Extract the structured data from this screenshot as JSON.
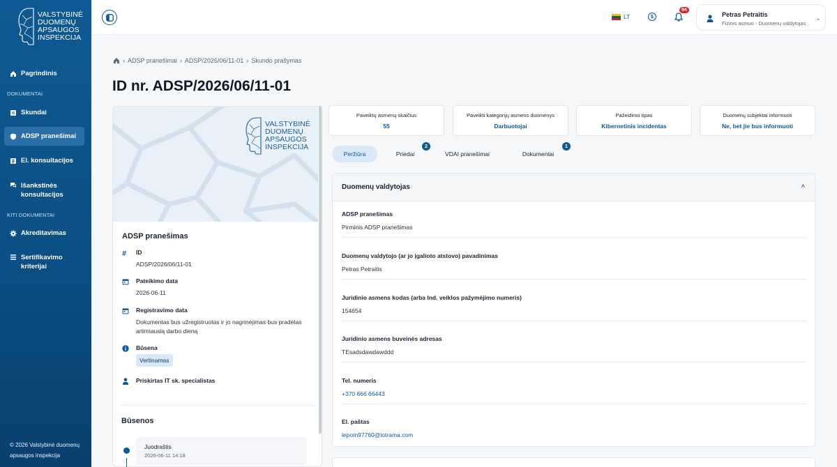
{
  "brand": {
    "line1": "VALSTYBINĖ",
    "line2": "DUOMENŲ",
    "line3": "APSAUGOS",
    "line4": "INSPEKCIJA"
  },
  "sidebar": {
    "items": [
      {
        "label": "Pagrindinis",
        "icon": "home-icon"
      },
      {
        "section": "DOKUMENTAI"
      },
      {
        "label": "Skundai",
        "icon": "document-icon"
      },
      {
        "label": "ADSP pranešimai",
        "icon": "shield-icon"
      },
      {
        "label": "El. konsultacijos",
        "icon": "list-icon"
      },
      {
        "label": "Išankstinės konsultacijos",
        "icon": "chat-icon"
      },
      {
        "section": "KITI DOKUMENTAI"
      },
      {
        "label": "Akreditavimas",
        "icon": "gear-icon"
      },
      {
        "label": "Sertifikavimo kriterijai",
        "icon": "list-icon"
      }
    ],
    "footer_line1": "© 2026 Valstybinė duomenų",
    "footer_line2": "apsaugos inspekcija"
  },
  "header": {
    "lang": "LT",
    "notifications_count": "94",
    "user_name": "Petras Petraitis",
    "user_role": "Fizinis asmuo - Duomenų valdytojas"
  },
  "breadcrumb": [
    "ADSP pranešimai",
    "ADSP/2026/06/11-01",
    "Skundo prašymas"
  ],
  "page_title": "ID nr. ADSP/2026/06/11-01",
  "left_card": {
    "title": "ADSP pranešimas",
    "id_label": "ID",
    "id_value": "ADSP/2026/06/11-01",
    "submit_label": "Pateikimo data",
    "submit_value": "2026-06-11",
    "register_label": "Registravimo data",
    "register_value": "Dokumentas bus užregistruotas ir jo nagrinėjimas bus pradėtas artimiausią darbo dieną",
    "status_label": "Būsena",
    "status_value": "Vertinamas",
    "assigned_label": "Priskirtas IT sk. specialistas",
    "states_title": "Būsenos",
    "state_name": "Juodraštis",
    "state_date": "2026-06-11 14:18"
  },
  "stats": [
    {
      "label": "Paveiktų asmenų skaičius",
      "value": "55"
    },
    {
      "label": "Paveikti kategorijų asmens duomenys",
      "value": "Darbuotojai"
    },
    {
      "label": "Pažeidimo tipas",
      "value": "Kibernetinis incidentas"
    },
    {
      "label": "Duomenų subjektai informuoti",
      "value": "Ne, bet jie bus informuoti"
    }
  ],
  "tabs": [
    {
      "label": "Peržiūra"
    },
    {
      "label": "Priedai",
      "badge": "2"
    },
    {
      "label": "VDAI pranešimai"
    },
    {
      "label": "Dokumentai",
      "badge": "1"
    }
  ],
  "section": {
    "title": "Duomenų valdytojas",
    "rows": [
      {
        "label": "ADSP pranešimas",
        "value": "Pirminis ADSP pranešimas"
      },
      {
        "label": "Duomenų valdytojo (ar jo įgalioto atstovo) pavadinimas",
        "value": "Petras Petraitis"
      },
      {
        "label": "Juridinio asmens kodas (arba Ind. veiklos pažymėjimo numeris)",
        "value": "154654"
      },
      {
        "label": "Juridinio asmens buveinės adresas",
        "value": "TEsadsdawdawddd"
      },
      {
        "label": "Tel. numeris",
        "value": "+370 666 66443"
      },
      {
        "label": "El. paštas",
        "value": "lepom97760@iotrama.com"
      }
    ]
  }
}
